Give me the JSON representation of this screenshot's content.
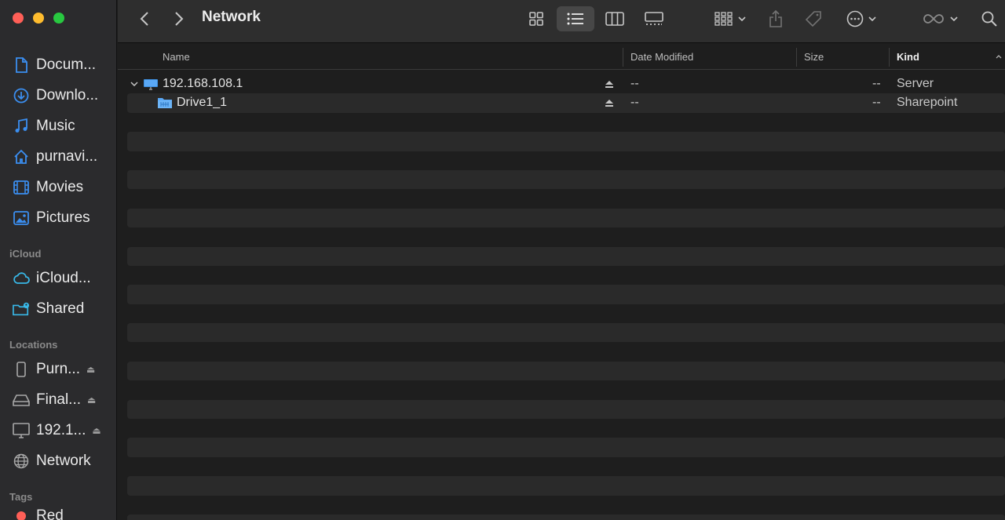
{
  "window": {
    "title": "Network"
  },
  "toolbar": {
    "back_icon": "chevron-left-icon",
    "forward_icon": "chevron-right-icon",
    "view_modes": [
      "icon-view",
      "list-view",
      "column-view",
      "gallery-view"
    ],
    "active_view": "list-view"
  },
  "sidebar": {
    "favorites": [
      {
        "label": "Docum...",
        "icon": "document-icon"
      },
      {
        "label": "Downlo...",
        "icon": "download-icon"
      },
      {
        "label": "Music",
        "icon": "music-icon"
      },
      {
        "label": "purnavi...",
        "icon": "home-icon"
      },
      {
        "label": "Movies",
        "icon": "film-icon"
      },
      {
        "label": "Pictures",
        "icon": "photo-icon"
      }
    ],
    "icloud_header": "iCloud",
    "icloud": [
      {
        "label": "iCloud...",
        "icon": "cloud-icon"
      },
      {
        "label": "Shared",
        "icon": "shared-folder-icon"
      }
    ],
    "locations_header": "Locations",
    "locations": [
      {
        "label": "Purn...",
        "icon": "phone-icon",
        "eject": true
      },
      {
        "label": "Final...",
        "icon": "drive-icon",
        "eject": true
      },
      {
        "label": "192.1...",
        "icon": "monitor-icon",
        "eject": true
      },
      {
        "label": "Network",
        "icon": "globe-icon",
        "eject": false
      }
    ],
    "tags_header": "Tags",
    "tags_partial": "Red"
  },
  "list": {
    "columns": {
      "name": "Name",
      "date": "Date Modified",
      "size": "Size",
      "kind": "Kind"
    },
    "sorted_by": "Kind",
    "rows": [
      {
        "name": "192.168.108.1",
        "date": "--",
        "size": "--",
        "kind": "Server",
        "expanded": true,
        "indent": 0
      },
      {
        "name": "Drive1_1",
        "date": "--",
        "size": "--",
        "kind": "Sharepoint",
        "expanded": false,
        "indent": 1
      }
    ]
  },
  "colors": {
    "accent": "#3b8ef0",
    "sidebar_bg": "#2b2b2d",
    "main_bg": "#1e1e1e",
    "stripe": "#2a2a2a"
  }
}
